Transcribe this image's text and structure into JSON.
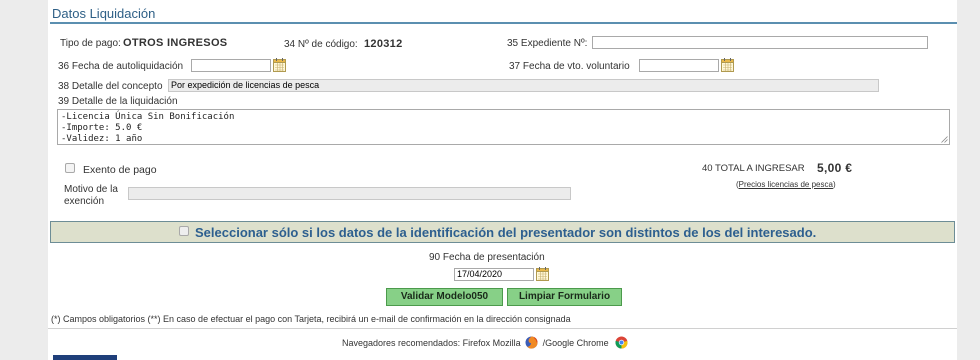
{
  "section": {
    "title": "Datos Liquidación"
  },
  "tipo_pago": {
    "label": "Tipo de pago:",
    "value": "OTROS INGRESOS"
  },
  "codigo": {
    "label": "34 Nº de código:",
    "value": "120312"
  },
  "expediente": {
    "label": "35 Expediente Nº:",
    "value": ""
  },
  "fecha_autoliquidacion": {
    "label": "36 Fecha de autoliquidación",
    "value": ""
  },
  "fecha_vto": {
    "label": "37 Fecha de vto. voluntario",
    "value": ""
  },
  "detalle_concepto": {
    "label": "38 Detalle del concepto",
    "value": "Por expedición de licencias de pesca"
  },
  "detalle_liquidacion": {
    "label": "39 Detalle de la liquidación",
    "value": "-Licencia Única Sin Bonificación\n-Importe: 5.0 €\n-Validez: 1 año"
  },
  "exento": {
    "label": "Exento de pago",
    "checked": false
  },
  "motivo_exencion": {
    "label_line1": "Motivo de la",
    "label_line2": "exención",
    "value": ""
  },
  "total": {
    "label": "40 TOTAL A INGRESAR",
    "value": "5,00 €"
  },
  "precios_link": {
    "open": "(",
    "text": "Precios licencias de pesca",
    "close": ")"
  },
  "presentador": {
    "label": "Seleccionar sólo si los datos de la identificación del presentador son distintos de los del interesado.",
    "checked": false
  },
  "fecha_presentacion": {
    "label": "90 Fecha de presentación",
    "value": "17/04/2020"
  },
  "buttons": {
    "validar": "Validar Modelo050",
    "limpiar": "Limpiar Formulario"
  },
  "footnote": "(*) Campos obligatorios (**) En caso de efectuar el pago con Tarjeta, recibirá un e-mail de confirmación en la dirección consignada",
  "browsers": {
    "label": "Navegadores recomendados: Firefox Mozilla",
    "separator": "/Google Chrome"
  },
  "colors": {
    "accent": "#2e5f86",
    "button": "#87d087",
    "bar": "#dde0cc"
  },
  "icons": [
    "calendar-icon",
    "firefox-icon",
    "chrome-icon"
  ]
}
